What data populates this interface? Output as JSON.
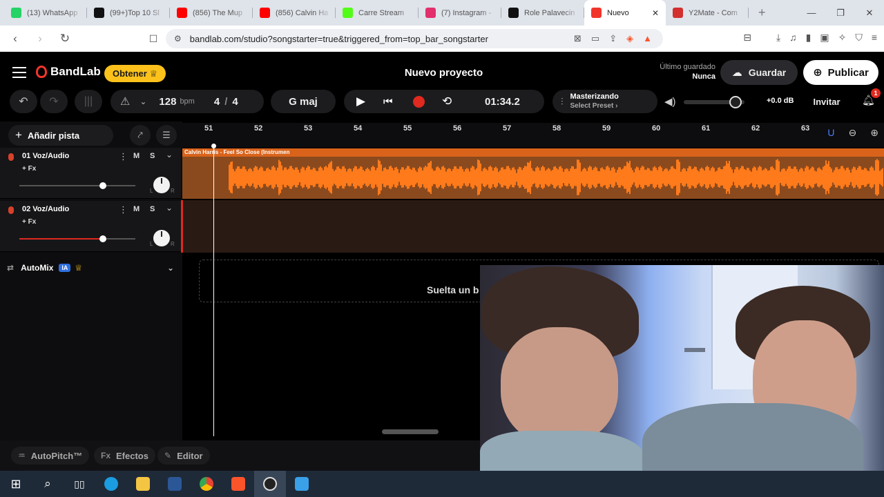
{
  "browser": {
    "tabs": [
      {
        "label": "(13) WhatsApp",
        "icon": "whatsapp-icon",
        "color": "#25d366"
      },
      {
        "label": "(99+)Top 10 Sl",
        "icon": "tiktok-icon",
        "color": "#111111"
      },
      {
        "label": "(856) The Mup",
        "icon": "youtube-icon",
        "color": "#ff0000"
      },
      {
        "label": "(856) Calvin Ha",
        "icon": "youtube-icon",
        "color": "#ff0000"
      },
      {
        "label": "Carre Stream",
        "icon": "kick-icon",
        "color": "#53fc18"
      },
      {
        "label": "(7) Instagram -",
        "icon": "instagram-icon",
        "color": "#e1306c"
      },
      {
        "label": "Role Palavecin",
        "icon": "tiktok-icon",
        "color": "#111111"
      },
      {
        "label": "Nuevo",
        "icon": "bandlab-icon",
        "color": "#f2352b"
      },
      {
        "label": "Y2Mate - Com",
        "icon": "y2mate-icon",
        "color": "#d32f2f"
      }
    ],
    "url": "bandlab.com/studio?songstarter=true&triggered_from=top_bar_songstarter"
  },
  "header": {
    "brand": "BandLab",
    "obtener": "Obtener ♕",
    "project_title": "Nuevo proyecto",
    "saved_label": "Último guardado",
    "saved_value": "Nunca",
    "save_button": "Guardar",
    "publish_button": "Publicar"
  },
  "transport": {
    "tempo": "128",
    "tempo_unit": "bpm",
    "time_sig_num": "4",
    "time_sig_sep": "/",
    "time_sig_den": "4",
    "key": "G maj",
    "time": "01:34.2",
    "mastering_title": "Masterizando",
    "mastering_preset": "Select Preset ›",
    "volume_db": "+0.0 dB",
    "volume_level": 0.85,
    "invite": "Invitar",
    "notifications": "1"
  },
  "sidebar": {
    "add_track": "Añadir pista",
    "add_track_plus": "+",
    "tracks": [
      {
        "name": "01  Voz/Audio",
        "fx": "+ Fx",
        "mute": "M",
        "solo": "S",
        "volume": 0.72,
        "accent": "#555555"
      },
      {
        "name": "02  Voz/Audio",
        "fx": "+ Fx",
        "mute": "M",
        "solo": "S",
        "volume": 0.72,
        "accent": "#e0291f"
      }
    ],
    "automix": "AutoMix",
    "automix_badge": "IA",
    "pan_l": "L",
    "pan_r": "R"
  },
  "timeline": {
    "bars": [
      "51",
      "52",
      "53",
      "54",
      "55",
      "56",
      "57",
      "58",
      "59",
      "60",
      "61",
      "62",
      "63"
    ],
    "clip_title": "Calvin Harris - Feel So Close (Instrumen",
    "drop_hint": "Suelta un b"
  },
  "bottom": {
    "autopitch": "AutoPitch™",
    "effects": "Efectos",
    "effects_prefix": "Fx",
    "editor": "Editor"
  },
  "colors": {
    "accent_orange": "#d9631b",
    "record_red": "#e0291f",
    "obtener_yellow": "#fcc21b"
  }
}
